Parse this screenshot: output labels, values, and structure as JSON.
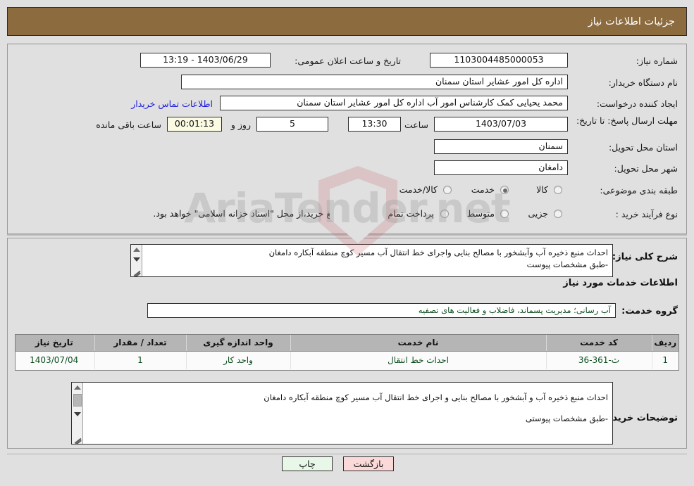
{
  "header": {
    "title": "جزئیات اطلاعات نیاز"
  },
  "form": {
    "need_number_label": "شماره نیاز:",
    "need_number_value": "1103004485000053",
    "announce_label": "تاریخ و ساعت اعلان عمومی:",
    "announce_value": "1403/06/29 - 13:19",
    "buyer_org_label": "نام دستگاه خریدار:",
    "buyer_org_value": "اداره کل امور عشایر استان سمنان",
    "creator_label": "ایجاد کننده درخواست:",
    "creator_value": "محمد یحیایی کمک کارشناس امور آب اداره کل امور عشایر استان سمنان",
    "contact_link": "اطلاعات تماس خریدار",
    "deadline_label": "مهلت ارسال پاسخ: تا تاریخ:",
    "deadline_date": "1403/07/03",
    "hour_label": "ساعت",
    "deadline_time": "13:30",
    "days_value": "5",
    "days_label": "روز و",
    "remaining_time": "00:01:13",
    "remaining_label": "ساعت باقی مانده",
    "province_label": "استان محل تحویل:",
    "province_value": "سمنان",
    "city_label": "شهر محل تحویل:",
    "city_value": "دامغان",
    "category_label": "طبقه بندی موضوعی:",
    "category_options": [
      {
        "label": "کالا",
        "selected": false
      },
      {
        "label": "خدمت",
        "selected": true
      },
      {
        "label": "کالا/خدمت",
        "selected": false
      }
    ],
    "purchase_label": "نوع فرآیند خرید :",
    "purchase_options": [
      {
        "label": "جزیی",
        "selected": false
      },
      {
        "label": "متوسط",
        "selected": false
      }
    ],
    "treasury_note": "پرداخت تمام یا بخشی از مبلغ خرید،از محل \"اسناد خزانه اسلامی\" خواهد بود."
  },
  "description": {
    "label": "شرح کلی نیاز:",
    "line1": "احداث منبع ذخیره آب وآبشخور با مصالح بنایی واجرای خط انتقال آب مسیر کوچ منطقه آبکاره دامغان",
    "line2": "-طبق مشخصات پیوست"
  },
  "services_section": {
    "heading": "اطلاعات خدمات مورد نیاز",
    "group_label": "گروه خدمت:",
    "group_value": "آب رسانی؛ مدیریت پسماند، فاضلاب و فعالیت های تصفیه"
  },
  "items_table": {
    "columns": [
      "ردیف",
      "کد خدمت",
      "نام خدمت",
      "واحد اندازه گیری",
      "تعداد / مقدار",
      "تاریخ نیاز"
    ],
    "rows": [
      {
        "row": "1",
        "code": "ث-361-36",
        "name": "احداث خط انتقال",
        "unit": "واحد کار",
        "qty": "1",
        "date": "1403/07/04"
      }
    ]
  },
  "buyer_notes": {
    "label": "توضیحات خریدار:",
    "line1": "احداث منبع ذخیره آب و آبشخور با مصالح بنایی و اجرای خط انتقال آب مسیر کوچ  منطقه آبکاره دامغان",
    "line2": "-طبق مشخصات پیوستی"
  },
  "buttons": {
    "print": "چاپ",
    "back": "بازگشت"
  },
  "watermark": {
    "text": "AriaTender.net"
  },
  "colors": {
    "header_brown": "#8c6b3f",
    "page_bg": "#e0e0e0",
    "table_header": "#b5b5b5",
    "link_blue": "#2020dd",
    "print_btn": "#e9f7e9",
    "back_btn": "#fcd9d9"
  }
}
